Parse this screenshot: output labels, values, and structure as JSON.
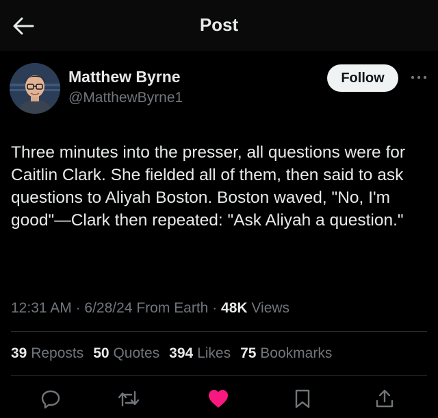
{
  "header": {
    "title": "Post"
  },
  "author": {
    "name": "Matthew Byrne",
    "handle": "@MatthewByrne1",
    "follow_label": "Follow"
  },
  "post": {
    "text": "Three minutes into the presser, all questions were for Caitlin Clark. She fielded all of them, then said to ask questions to Aliyah Boston. Boston waved, \"No, I'm good\"—Clark then repeated: \"Ask Aliyah a question.\"",
    "time": "12:31 AM",
    "date": "6/28/24",
    "source": "From Earth",
    "views_count": "48K",
    "views_label": "Views"
  },
  "stats": {
    "reposts_count": "39",
    "reposts_label": "Reposts",
    "quotes_count": "50",
    "quotes_label": "Quotes",
    "likes_count": "394",
    "likes_label": "Likes",
    "bookmarks_count": "75",
    "bookmarks_label": "Bookmarks"
  },
  "actions": {
    "icons": [
      "reply-icon",
      "repost-icon",
      "like-icon",
      "bookmark-icon",
      "share-icon"
    ],
    "liked": true
  },
  "colors": {
    "background": "#000000",
    "text": "#e7e9ea",
    "muted": "#71767b",
    "like": "#f91880",
    "follow_bg": "#eff3f4"
  }
}
